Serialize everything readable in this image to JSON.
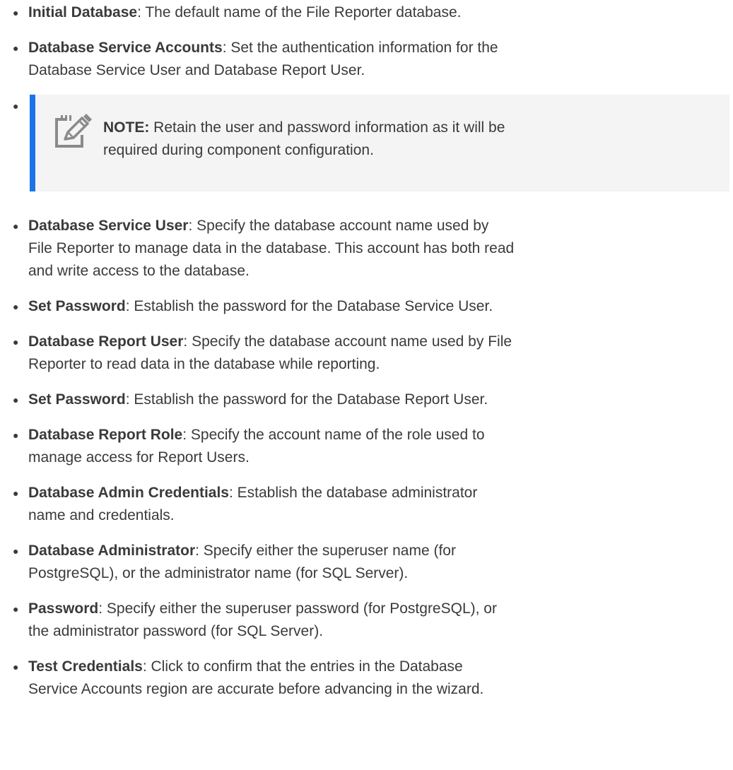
{
  "items_before_note": [
    {
      "term": "Initial Database",
      "description": ": The default name of the File Reporter database."
    },
    {
      "term": "Database Service Accounts",
      "description": ": Set the authentication information for the Database Service User and Database Report User."
    }
  ],
  "note": {
    "label": "NOTE:",
    "text": " Retain the user and password information as it will be required during component configuration.",
    "icon": "note-pencil-icon"
  },
  "items_after_note": [
    {
      "term": "Database Service User",
      "description": ": Specify the database account name used by File Reporter to manage data in the database. This account has both read and write access to the database."
    },
    {
      "term": "Set Password",
      "description": ": Establish the password for the Database Service User."
    },
    {
      "term": "Database Report User",
      "description": ": Specify the database account name used by File Reporter to read data in the database while reporting."
    },
    {
      "term": "Set Password",
      "description": ": Establish the password for the Database Report User."
    },
    {
      "term": "Database Report Role",
      "description": ": Specify the account name of the role used to manage access for Report Users."
    },
    {
      "term": "Database Admin Credentials",
      "description": ": Establish the database administrator name and credentials."
    },
    {
      "term": "Database Administrator",
      "description": ": Specify either the superuser name (for PostgreSQL), or the administrator name (for SQL Server)."
    },
    {
      "term": "Password",
      "description": ": Specify either the superuser password (for PostgreSQL), or the administrator password (for SQL Server)."
    },
    {
      "term": "Test Credentials",
      "description": ": Click to confirm that the entries in the Database Service Accounts region are accurate before advancing in the wizard."
    }
  ],
  "colors": {
    "text": "#3a3a3a",
    "note_accent": "#1a73e8",
    "note_background": "#f4f4f4",
    "icon_gray": "#8a8a8a"
  }
}
